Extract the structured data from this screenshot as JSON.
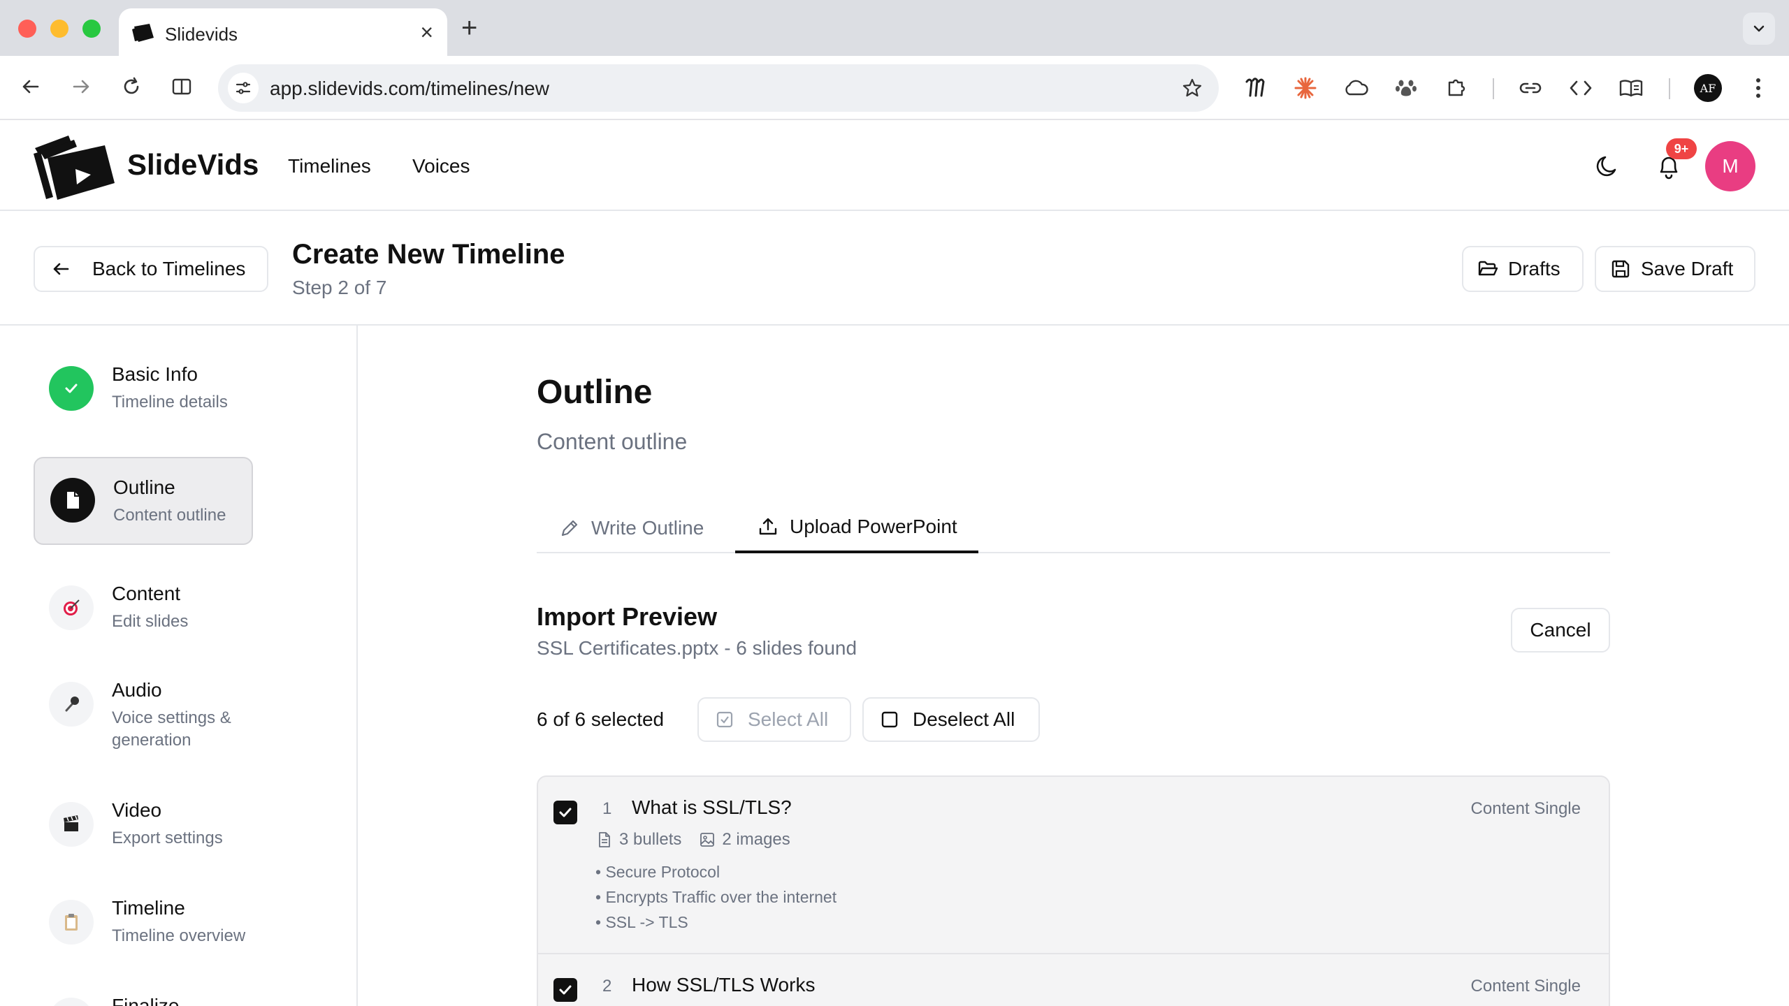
{
  "browser": {
    "tab_title": "Slidevids",
    "url": "app.slidevids.com/timelines/new",
    "profile_initials": "AF"
  },
  "app": {
    "logo_text": "SlideVids",
    "nav": [
      "Timelines",
      "Voices"
    ],
    "notification_badge": "9+",
    "avatar_initial": "M"
  },
  "subheader": {
    "back_label": "Back to Timelines",
    "title": "Create New Timeline",
    "step": "Step 2 of 7",
    "drafts_label": "Drafts",
    "save_draft_label": "Save Draft"
  },
  "steps": [
    {
      "title": "Basic Info",
      "desc": "Timeline details",
      "icon": "check-icon",
      "state": "done"
    },
    {
      "title": "Outline",
      "desc": "Content outline",
      "icon": "document-icon",
      "state": "current"
    },
    {
      "title": "Content",
      "desc": "Edit slides",
      "icon": "target-icon",
      "state": "pending"
    },
    {
      "title": "Audio",
      "desc": "Voice settings & generation",
      "icon": "microphone-icon",
      "state": "pending"
    },
    {
      "title": "Video",
      "desc": "Export settings",
      "icon": "clapper-icon",
      "state": "pending"
    },
    {
      "title": "Timeline",
      "desc": "Timeline overview",
      "icon": "clipboard-icon",
      "state": "pending"
    },
    {
      "title": "Finalize",
      "desc": "",
      "icon": "check-box-icon",
      "state": "pending"
    }
  ],
  "main": {
    "title": "Outline",
    "subtitle": "Content outline",
    "tabs": [
      {
        "label": "Write Outline",
        "icon": "pencil-icon",
        "active": false
      },
      {
        "label": "Upload PowerPoint",
        "icon": "upload-icon",
        "active": true
      }
    ],
    "import": {
      "title": "Import Preview",
      "file_info": "SSL Certificates.pptx - 6 slides found",
      "cancel_label": "Cancel",
      "selected_text": "6 of 6 selected",
      "select_all_label": "Select All",
      "deselect_all_label": "Deselect All"
    },
    "slides": [
      {
        "num": "1",
        "title": "What is SSL/TLS?",
        "type": "Content Single",
        "bullets_meta": "3 bullets",
        "images_meta": "2 images",
        "bullets": [
          "• Secure Protocol",
          "• Encrypts Traffic over the internet",
          "• SSL -> TLS"
        ],
        "checked": true
      },
      {
        "num": "2",
        "title": "How SSL/TLS Works",
        "type": "Content Single",
        "checked": true
      }
    ]
  },
  "colors": {
    "accent": "#111111",
    "success": "#22c55e",
    "avatar": "#e93d82",
    "badge": "#ef4444",
    "muted_text": "#6b7280"
  }
}
